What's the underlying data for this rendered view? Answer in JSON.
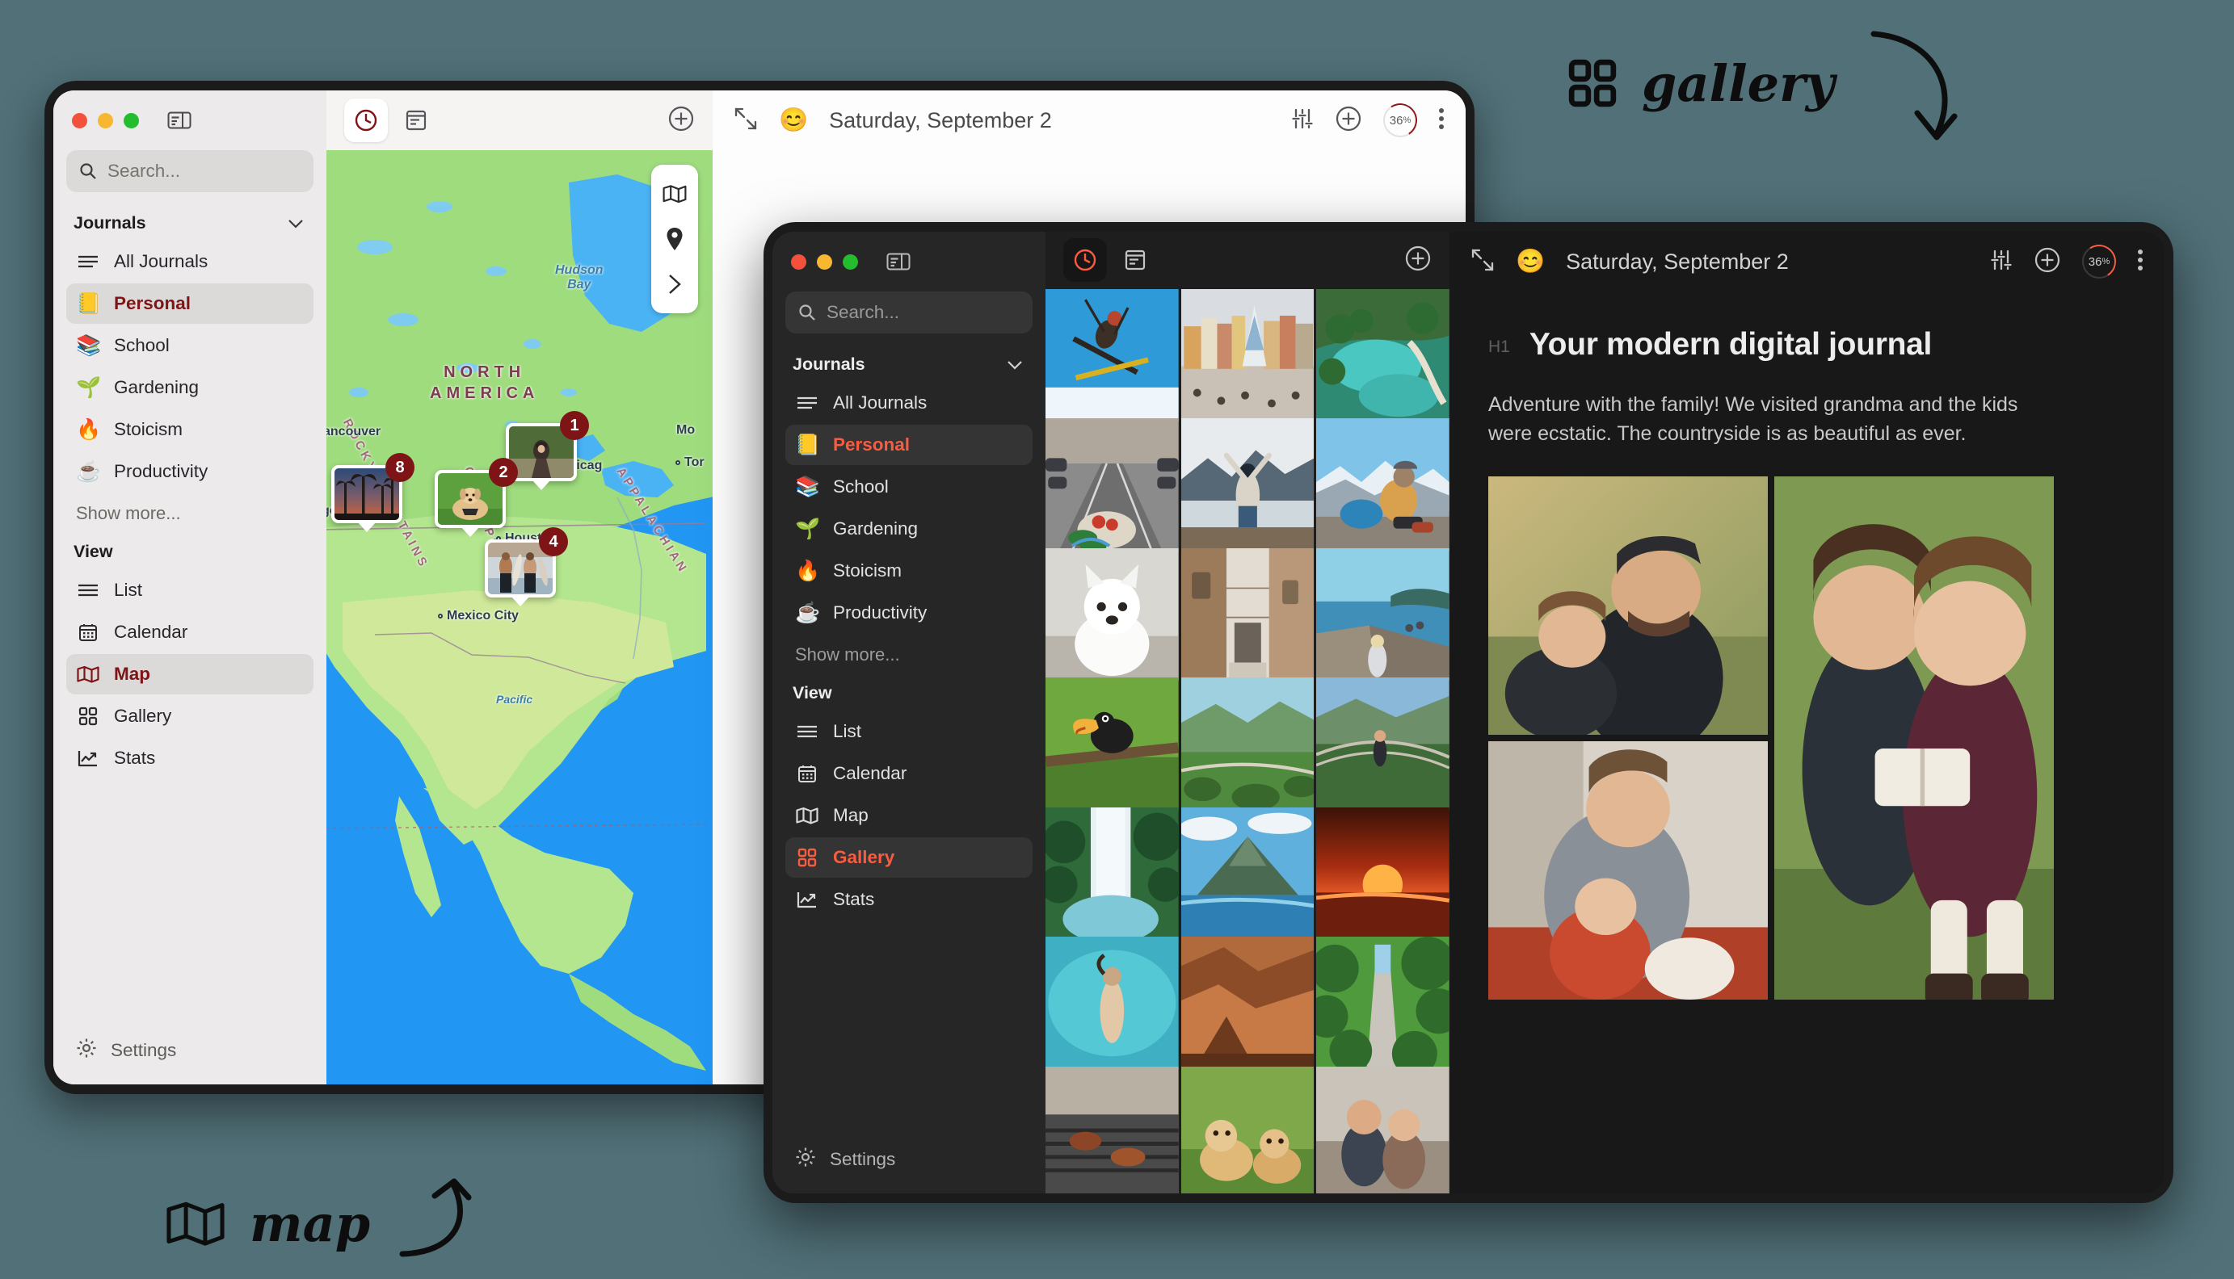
{
  "annotations": [
    {
      "id": "gallery-annotation",
      "icon": "grid-icon",
      "label": "gallery"
    },
    {
      "id": "map-annotation",
      "icon": "map-icon",
      "label": "map"
    }
  ],
  "window_light": {
    "traffic_lights": [
      "close",
      "minimize",
      "maximize"
    ],
    "sidebar_toggle_icon": "sidebar-toggle-icon",
    "search": {
      "placeholder": "Search...",
      "value": "",
      "icon": "search-icon"
    },
    "journals": {
      "title": "Journals",
      "collapse_icon": "chevron-down-icon",
      "items": [
        {
          "label": "All Journals",
          "icon": "list-lines-icon",
          "active": false
        },
        {
          "label": "Personal",
          "emoji": "📒",
          "active": true
        },
        {
          "label": "School",
          "emoji": "📚",
          "active": false
        },
        {
          "label": "Gardening",
          "emoji": "🌱",
          "active": false
        },
        {
          "label": "Stoicism",
          "emoji": "🔥",
          "active": false
        },
        {
          "label": "Productivity",
          "emoji": "☕",
          "active": false
        }
      ],
      "show_more": "Show more..."
    },
    "view": {
      "title": "View",
      "items": [
        {
          "label": "List",
          "icon": "list-icon",
          "active": false
        },
        {
          "label": "Calendar",
          "icon": "calendar-icon",
          "active": false
        },
        {
          "label": "Map",
          "icon": "map-icon",
          "active": true
        },
        {
          "label": "Gallery",
          "icon": "grid-icon",
          "active": false
        },
        {
          "label": "Stats",
          "icon": "chart-line-icon",
          "active": false
        }
      ]
    },
    "settings": {
      "label": "Settings",
      "icon": "gear-icon"
    },
    "toolbar": {
      "timeline_icon": "clock-icon",
      "entries_icon": "document-icon",
      "add_icon": "plus-circle-icon",
      "selected": "clock-icon"
    },
    "map_controls": [
      {
        "icon": "map-icon"
      },
      {
        "icon": "location-pin-icon"
      },
      {
        "icon": "chevron-right-icon"
      }
    ],
    "map": {
      "continent_label": "NORTH\nAMERICA",
      "labels": [
        {
          "text": "Hudson\nBay",
          "type": "water"
        },
        {
          "text": "NORTH AMERICA",
          "type": "continent"
        },
        {
          "text": "ROCKY MOUNTAINS",
          "type": "range"
        },
        {
          "text": "GREAT PLAINS",
          "type": "range"
        },
        {
          "text": "APPALACHIAN",
          "type": "range"
        },
        {
          "text": "Vancouver",
          "type": "city"
        },
        {
          "text": "Chicago",
          "type": "city"
        },
        {
          "text": "Toronto",
          "type": "city"
        },
        {
          "text": "Montreal",
          "type": "city"
        },
        {
          "text": "Los Angeles",
          "type": "city"
        },
        {
          "text": "Dallas",
          "type": "city"
        },
        {
          "text": "Houston",
          "type": "city"
        },
        {
          "text": "Mexico City",
          "type": "city"
        }
      ],
      "pins": [
        {
          "count": "1",
          "photo": "woman-hat-path"
        },
        {
          "count": "2",
          "photo": "golden-retriever-grass"
        },
        {
          "count": "8",
          "photo": "palm-trees-sunset"
        },
        {
          "count": "4",
          "photo": "surfers-beach"
        }
      ]
    },
    "editor_toolbar": {
      "expand_icon": "expand-arrows-icon",
      "mood_emoji": "😊",
      "date": "Saturday, September 2",
      "sliders_icon": "sliders-icon",
      "add_icon": "plus-circle-icon",
      "progress": "36",
      "progress_unit": "%",
      "more_icon": "more-vertical-icon"
    }
  },
  "window_dark": {
    "traffic_lights": [
      "close",
      "minimize",
      "maximize"
    ],
    "sidebar_toggle_icon": "sidebar-toggle-icon",
    "search": {
      "placeholder": "Search...",
      "value": "",
      "icon": "search-icon"
    },
    "journals": {
      "title": "Journals",
      "collapse_icon": "chevron-down-icon",
      "items": [
        {
          "label": "All Journals",
          "icon": "list-lines-icon",
          "active": false
        },
        {
          "label": "Personal",
          "emoji": "📒",
          "active": true
        },
        {
          "label": "School",
          "emoji": "📚",
          "active": false
        },
        {
          "label": "Gardening",
          "emoji": "🌱",
          "active": false
        },
        {
          "label": "Stoicism",
          "emoji": "🔥",
          "active": false
        },
        {
          "label": "Productivity",
          "emoji": "☕",
          "active": false
        }
      ],
      "show_more": "Show more..."
    },
    "view": {
      "title": "View",
      "items": [
        {
          "label": "List",
          "icon": "list-icon",
          "active": false
        },
        {
          "label": "Calendar",
          "icon": "calendar-icon",
          "active": false
        },
        {
          "label": "Map",
          "icon": "map-icon",
          "active": false
        },
        {
          "label": "Gallery",
          "icon": "grid-icon",
          "active": true
        },
        {
          "label": "Stats",
          "icon": "chart-line-icon",
          "active": false
        }
      ]
    },
    "settings": {
      "label": "Settings",
      "icon": "gear-icon"
    },
    "toolbar": {
      "timeline_icon": "clock-icon",
      "entries_icon": "document-icon",
      "add_icon": "plus-circle-icon",
      "selected": "clock-icon"
    },
    "gallery": {
      "tiles": [
        "skier-jump-blue-sky",
        "city-square-christmas-tree",
        "aerial-turquoise-lakes",
        "tram-street-bicycle-groceries",
        "woman-arms-up-mountain-lake",
        "woman-backpack-snowy-peaks",
        "white-samoyed-puppy",
        "old-town-stone-alley",
        "walkway-sea-island-view",
        "toucan-on-branch",
        "green-valley-rope-bridge",
        "hiker-suspension-bridge",
        "waterfall-jungle",
        "volcano-lake-clouds",
        "red-sunset-ocean",
        "woman-floating-turquoise-water",
        "canyon-rock-formation",
        "palm-road-tropical",
        "barbecue-grill",
        "golden-retriever-puppies",
        "couple-hug-outdoors"
      ]
    },
    "editor_toolbar": {
      "expand_icon": "expand-arrows-icon",
      "mood_emoji": "😊",
      "date": "Saturday, September 2",
      "sliders_icon": "sliders-icon",
      "add_icon": "plus-circle-icon",
      "progress": "36",
      "progress_unit": "%",
      "more_icon": "more-vertical-icon"
    },
    "entry": {
      "heading_tag": "H1",
      "heading": "Your modern digital journal",
      "body": "Adventure with the family! We visited grandma and the kids were ecstatic. The countryside is as beautiful as ever.",
      "photos": [
        "father-son-laughing-field",
        "two-girls-reading-book",
        "mother-baby-kitchen"
      ]
    }
  },
  "colors": {
    "page_background": "#517078",
    "light_sidebar": "#eceaea",
    "dark_sidebar": "#262626",
    "dark_editor": "#181818",
    "accent_light": "#7f1417",
    "accent_dark": "#fa5c40",
    "map_land": "#8fd07a",
    "map_water": "#2196f3"
  }
}
